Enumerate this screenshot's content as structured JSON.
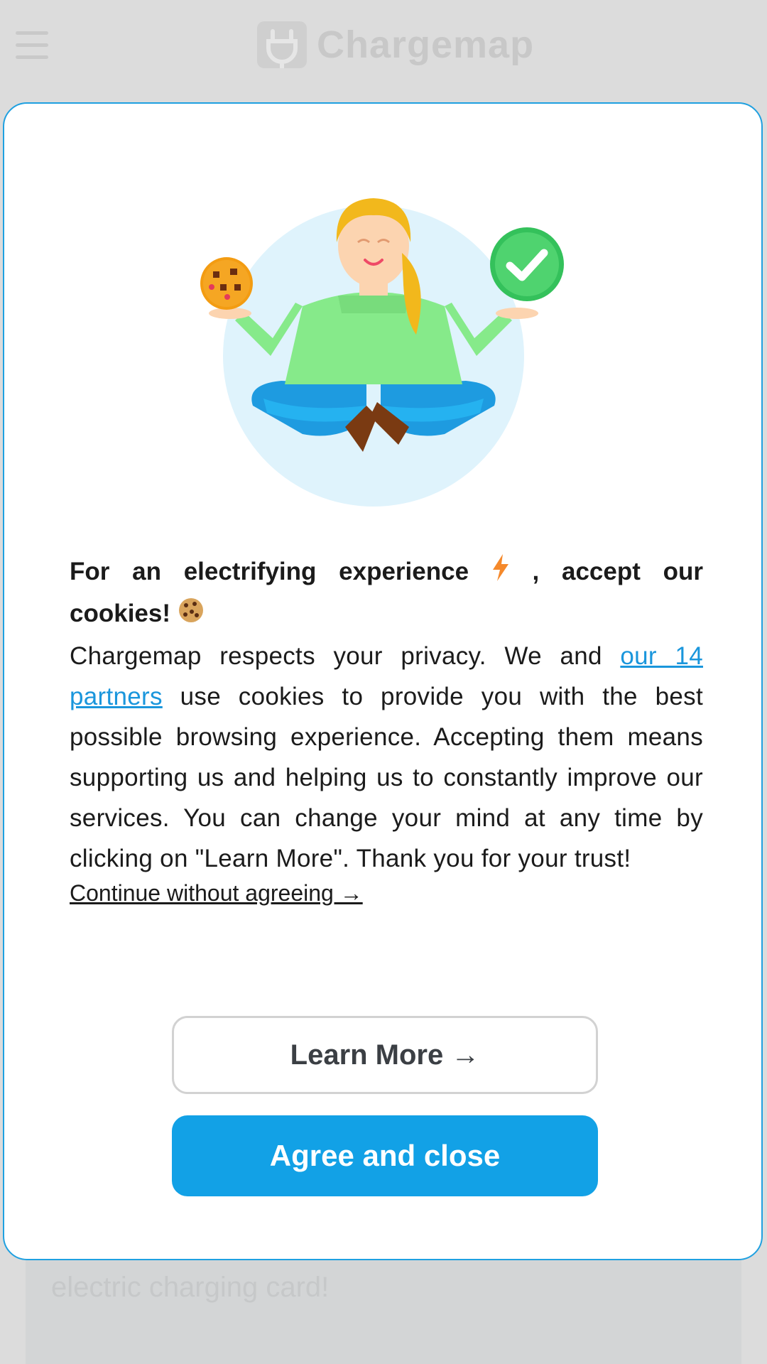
{
  "app": {
    "logo_text": "Chargemap"
  },
  "background": {
    "card_text": "electric charging card!"
  },
  "modal": {
    "headline_line1": "For an electrifying experience",
    "headline_line1_end": ", accept our",
    "headline_line2": "cookies!",
    "body_prefix": "Chargemap respects your privacy. We and ",
    "partners_link": "our 14 partners",
    "body_suffix": " use cookies to provide you with the best possible browsing experience. Accepting them means supporting us and helping us to constantly improve our services. You can change your mind at any time by clicking on \"Learn More\". Thank you for your trust!",
    "continue_link": "Continue without agreeing →",
    "learn_more_button": "Learn More →",
    "agree_button": "Agree and close"
  },
  "icons": {
    "menu": "hamburger-menu-icon",
    "logo": "plug-logo-icon",
    "lightning": "lightning-icon",
    "cookie": "cookie-icon",
    "check": "check-circle-icon"
  },
  "colors": {
    "accent": "#12a1e6",
    "link": "#1a96dc",
    "overlay": "#dcdcdc",
    "lightning": "#f5892b"
  }
}
